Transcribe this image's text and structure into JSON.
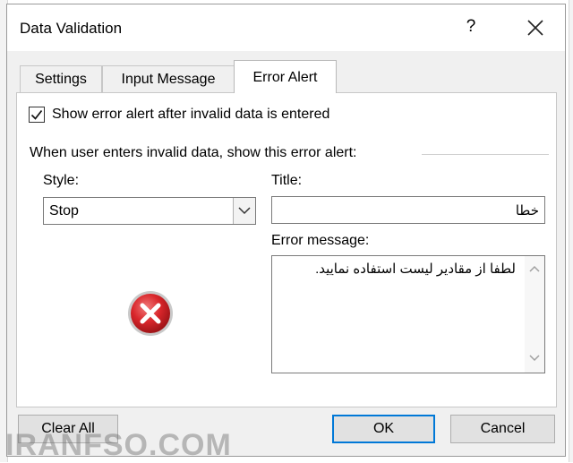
{
  "window": {
    "title": "Data Validation",
    "help": "?"
  },
  "tabs": [
    {
      "label": "Settings",
      "active": false
    },
    {
      "label": "Input Message",
      "active": false
    },
    {
      "label": "Error Alert",
      "active": true
    }
  ],
  "error_alert": {
    "show_checkbox_label": "Show error alert after invalid data is entered",
    "show_checked": true,
    "group_label": "When user enters invalid data, show this error alert:",
    "style_label": "Style:",
    "style_value": "Stop",
    "title_label": "Title:",
    "title_value": "خطا",
    "message_label": "Error message:",
    "message_value": "لطفا از مقادیر لیست استفاده نمایید.",
    "style_icon": "error-stop-icon"
  },
  "buttons": {
    "clear_all": "Clear All",
    "ok": "OK",
    "cancel": "Cancel"
  },
  "watermark": "IRANFSO.COM",
  "colors": {
    "accent": "#0078d7",
    "error_red": "#d9262b"
  }
}
